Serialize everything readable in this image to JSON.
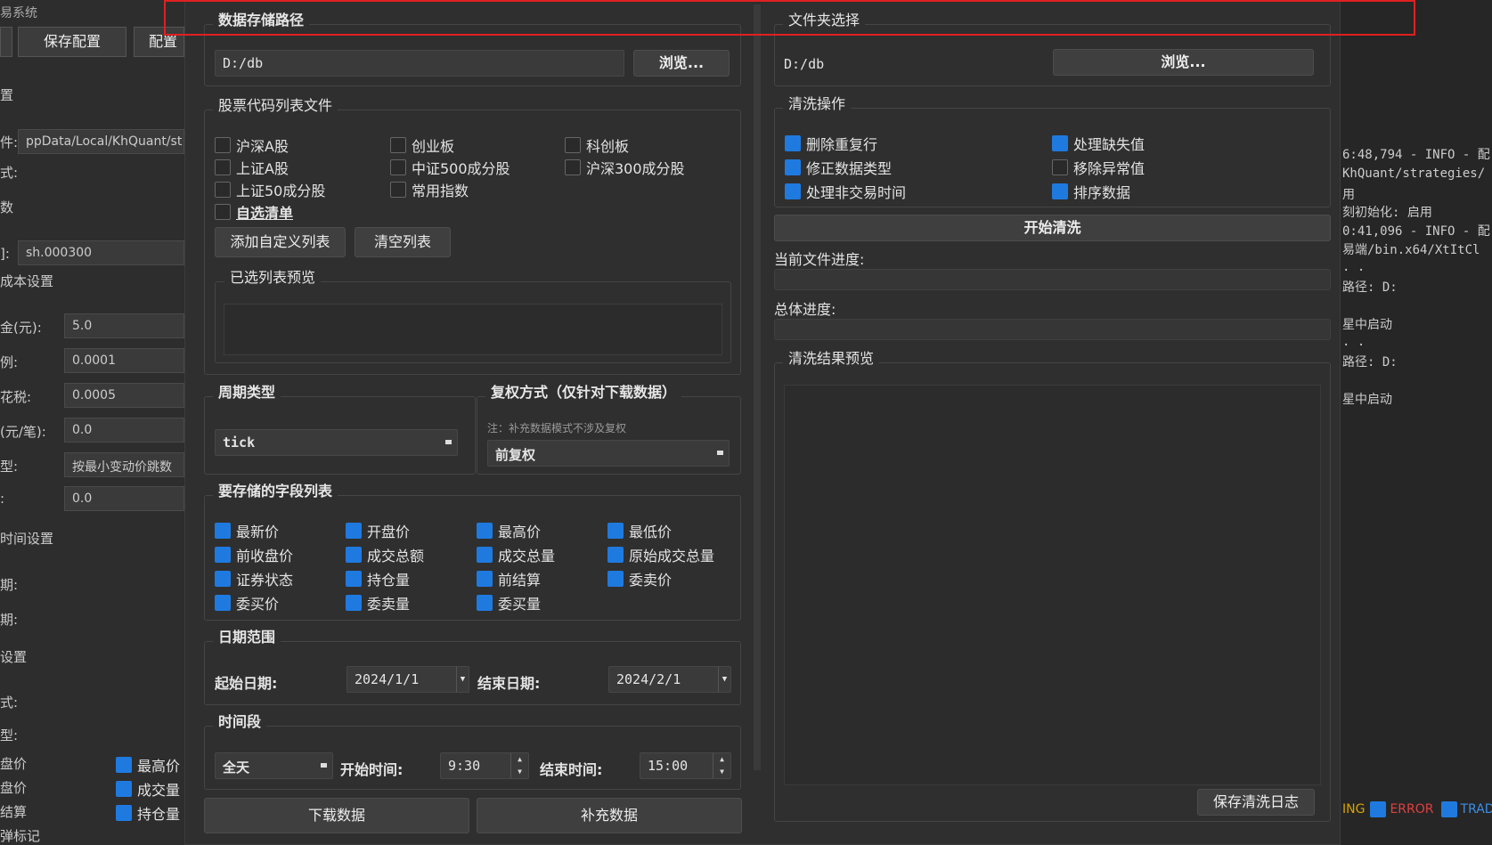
{
  "bg_left": {
    "title": "易系统",
    "buttons": [
      "保存配置",
      "配置"
    ],
    "labels": [
      "置",
      "件:",
      "式:",
      "数",
      "]:",
      "成本设置",
      "金(元):",
      "例:",
      "花税:",
      "(元/笔):",
      "型:",
      ":",
      "时间设置",
      "期:",
      "期:",
      "设置",
      "式:",
      "型:",
      "盘价",
      "盘价",
      "结算",
      "弹标记"
    ],
    "inputs": [
      "ppData/Local/KhQuant/st",
      "sh.000300",
      "5.0",
      "0.0001",
      "0.0005",
      "0.0",
      "按最小变动价跳数",
      "0.0"
    ],
    "checks": [
      "最高价",
      "成交量",
      "持仓量"
    ]
  },
  "bg_right": {
    "log": [
      "6:48,794 - INFO - 配",
      "KhQuant/strategies/",
      "用",
      "刻初始化: 启用",
      "0:41,096 - INFO - 配",
      "易端/bin.x64/XtItCl",
      ". .",
      "路径: D:",
      "",
      "星中启动",
      ". .",
      "路径: D:",
      "",
      "星中启动"
    ],
    "filters": [
      "ING",
      "ERROR",
      "TRADE"
    ]
  },
  "left": {
    "storage": {
      "title": "数据存储路径",
      "path": "D:/db",
      "browse": "浏览..."
    },
    "stock_list": {
      "title": "股票代码列表文件",
      "items": [
        {
          "label": "沪深A股",
          "checked": false
        },
        {
          "label": "创业板",
          "checked": false
        },
        {
          "label": "科创板",
          "checked": false
        },
        {
          "label": "上证A股",
          "checked": false
        },
        {
          "label": "中证500成分股",
          "checked": false
        },
        {
          "label": "沪深300成分股",
          "checked": false
        },
        {
          "label": "上证50成分股",
          "checked": false
        },
        {
          "label": "常用指数",
          "checked": false
        },
        {
          "label": "自选清单",
          "checked": false
        }
      ],
      "add_btn": "添加自定义列表",
      "clear_btn": "清空列表",
      "preview_title": "已选列表预览"
    },
    "period": {
      "title": "周期类型",
      "value": "tick"
    },
    "adjust": {
      "title": "复权方式（仅针对下载数据）",
      "note": "注：补充数据模式不涉及复权",
      "value": "前复权"
    },
    "fields": {
      "title": "要存储的字段列表",
      "items": [
        "最新价",
        "开盘价",
        "最高价",
        "最低价",
        "前收盘价",
        "成交总额",
        "成交总量",
        "原始成交总量",
        "证券状态",
        "持仓量",
        "前结算",
        "委卖价",
        "委买价",
        "委卖量",
        "委买量"
      ]
    },
    "dates": {
      "title": "日期范围",
      "start_label": "起始日期:",
      "start": "2024/1/1",
      "end_label": "结束日期:",
      "end": "2024/2/1"
    },
    "time": {
      "title": "时间段",
      "mode": "全天",
      "start_label": "开始时间:",
      "start": "9:30",
      "end_label": "结束时间:",
      "end": "15:00"
    },
    "download_btn": "下载数据",
    "supplement_btn": "补充数据"
  },
  "right": {
    "folder": {
      "title": "文件夹选择",
      "path": "D:/db",
      "browse": "浏览..."
    },
    "clean": {
      "title": "清洗操作",
      "items": [
        {
          "label": "删除重复行",
          "checked": true
        },
        {
          "label": "处理缺失值",
          "checked": true
        },
        {
          "label": "修正数据类型",
          "checked": true
        },
        {
          "label": "移除异常值",
          "checked": false
        },
        {
          "label": "处理非交易时间",
          "checked": true
        },
        {
          "label": "排序数据",
          "checked": true
        }
      ]
    },
    "start_btn": "开始清洗",
    "file_progress": "当前文件进度:",
    "total_progress": "总体进度:",
    "preview_title": "清洗结果预览",
    "save_log_btn": "保存清洗日志"
  },
  "colors": {
    "accent": "#1f7ae0",
    "highlight": "#e02020"
  }
}
